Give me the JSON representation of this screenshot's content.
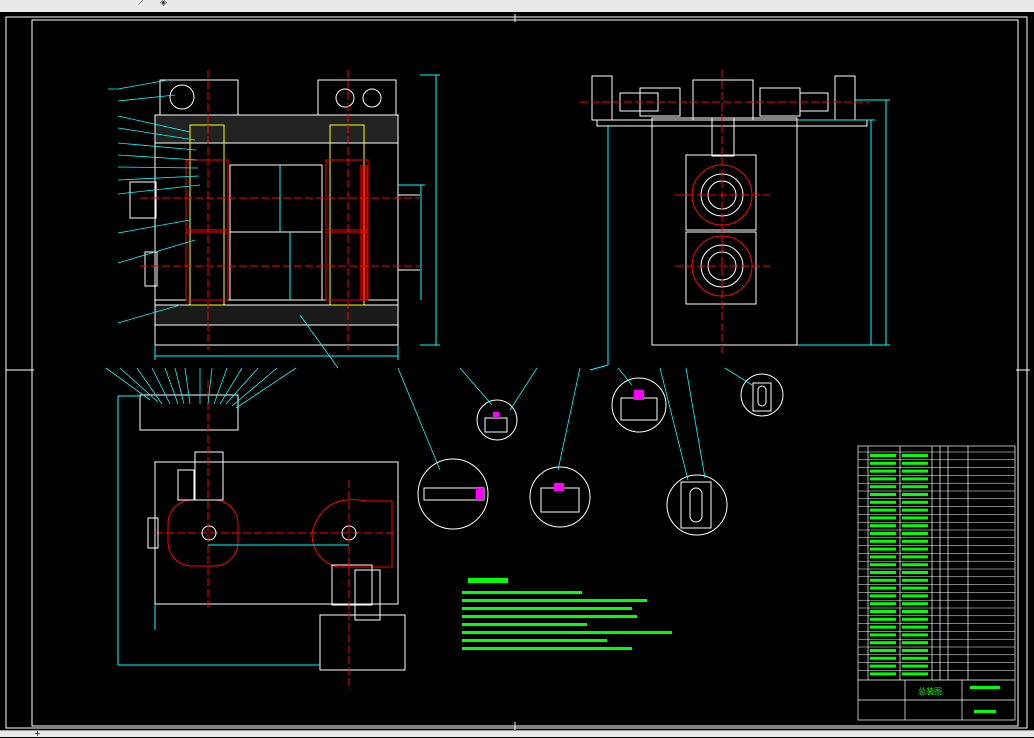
{
  "app": {
    "toolbar_icons": [
      "cursor-icon",
      "shield-icon"
    ]
  },
  "drawing": {
    "colors": {
      "background": "#000000",
      "outline": "#ffffff",
      "dimension": "#00ffff",
      "section": "#ff0000",
      "accent": "#ffff00",
      "green": "#00ff00",
      "magenta": "#ff00ff"
    },
    "title_block": {
      "title": "总装图"
    }
  }
}
